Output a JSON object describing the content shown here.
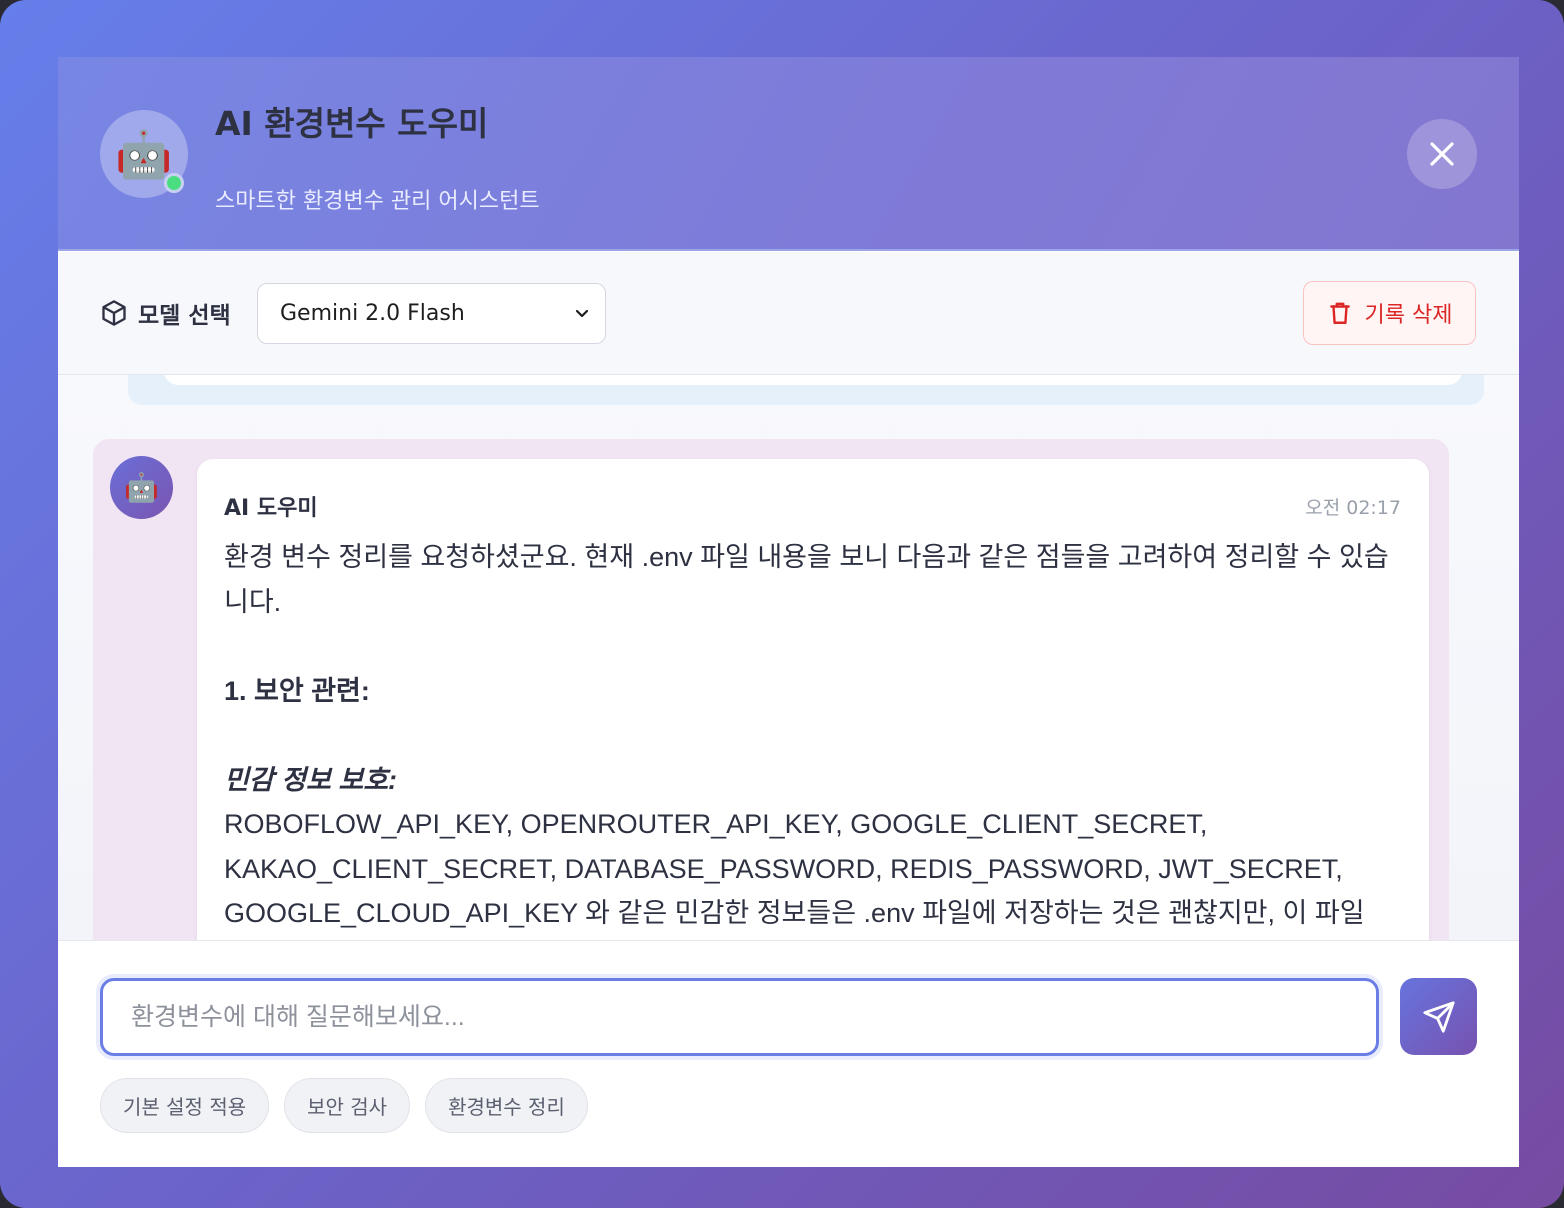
{
  "header": {
    "avatar_icon": "robot-icon",
    "title": "AI 환경변수 도우미",
    "subtitle": "스마트한 환경변수 관리 어시스턴트",
    "status": "online"
  },
  "toolbar": {
    "model_label": "모델 선택",
    "model_selected": "Gemini 2.0 Flash",
    "clear_label": "기록 삭제"
  },
  "message": {
    "sender": "AI 도우미",
    "time": "오전 02:17",
    "intro": "환경 변수 정리를 요청하셨군요. 현재 .env 파일 내용을 보니 다음과 같은 점들을 고려하여 정리할 수 있습니다.",
    "heading": "1. 보안 관련:",
    "subheading": "민감 정보 보호:",
    "body": "ROBOFLOW_API_KEY, OPENROUTER_API_KEY, GOOGLE_CLIENT_SECRET, KAKAO_CLIENT_SECRET, DATABASE_PASSWORD, REDIS_PASSWORD, JWT_SECRET, GOOGLE_CLOUD_API_KEY 와 같은 민감한 정보들은 .env 파일에 저장하는 것은 괜찮지만, 이 파일"
  },
  "input": {
    "placeholder": "환경변수에 대해 질문해보세요..."
  },
  "chips": [
    "기본 설정 적용",
    "보안 검사",
    "환경변수 정리"
  ],
  "colors": {
    "accent": "#667eea",
    "accent_end": "#764ba2",
    "danger": "#dc2626",
    "online": "#4ade80"
  }
}
